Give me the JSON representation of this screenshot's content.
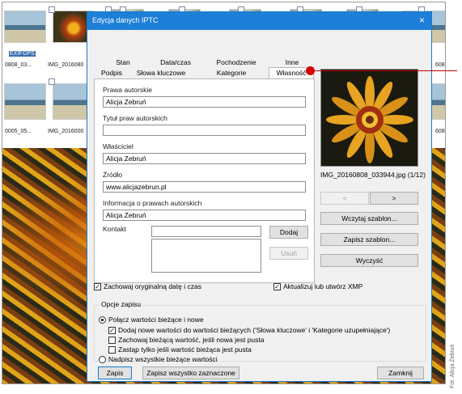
{
  "thumbnails": {
    "badges": [
      "EXIF",
      "GPS"
    ],
    "row1_labels": [
      "0808_03...",
      "IMG_2016080",
      "6080"
    ],
    "row2_labels": [
      "0005_05...",
      "IMG_2016000",
      "6080"
    ]
  },
  "dialog": {
    "title": "Edycja danych IPTC",
    "close": "×",
    "tabs_row1": [
      "Stan",
      "Data/czas",
      "Pochodzenie",
      "Inne"
    ],
    "tabs_row2": [
      "Podpis",
      "Słowa kluczowe",
      "Kategorie",
      "Własność"
    ],
    "active_tab": "Własność",
    "fields": {
      "copyright_label": "Prawa autorskie",
      "copyright_value": "Alicja Zebruń",
      "copyright_title_label": "Tytuł praw autorskich",
      "copyright_title_value": "",
      "owner_label": "Właściciel",
      "owner_value": "Alicja Zebruń",
      "source_label": "Źródło",
      "source_value": "www.alicjazebrun.pl",
      "rights_info_label": "Informacja o prawach autorskich",
      "rights_info_value": "Alicja Zebruń",
      "contact_label": "Kontakt",
      "contact_value": ""
    },
    "buttons": {
      "add": "Dodaj",
      "remove": "Usuń",
      "prev": "<",
      "next": ">",
      "load_template": "Wczytaj szablon...",
      "save_template": "Zapisz szablon...",
      "clear": "Wyczyść",
      "save": "Zapis",
      "save_all": "Zapisz wszystko zaznaczone",
      "close": "Zamknij"
    },
    "preview_caption": "IMG_20160808_033944.jpg (1/12)",
    "checkboxes": {
      "keep_date": "Zachowaj oryginalną datę i czas",
      "update_xmp": "Aktualizuj lub utwórz XMP"
    },
    "save_options": {
      "label": "Opcje zapisu",
      "merge": "Połącz wartości bieżące i nowe",
      "add_new": "Dodaj nowe wartości do wartości bieżących ('Słowa kluczowe' i 'Kategorie uzupełniające')",
      "keep_current": "Zachowaj bieżącą wartość, jeśli nowa jest pusta",
      "replace_only": "Zastąp tylko jeśli wartość bieżąca jest pusta",
      "overwrite": "Nadpisz wszystkie bieżące wartości"
    }
  },
  "credit": "Fot. Alicja Żebruń",
  "colors": {
    "titlebar": "#1d7fd8",
    "callout": "#d40000"
  }
}
